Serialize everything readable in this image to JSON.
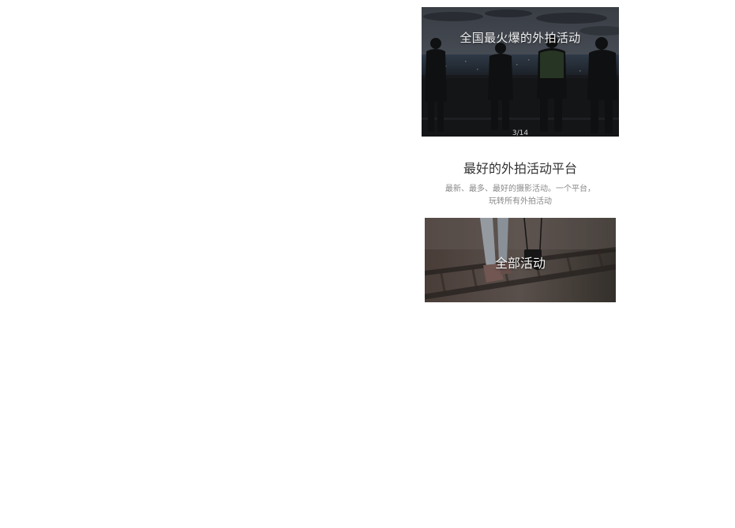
{
  "banner": {
    "title": "全国最火爆的外拍活动",
    "counter": "3/14",
    "image": "photographers-city-night-photo"
  },
  "intro": {
    "heading": "最好的外拍活动平台",
    "subtitle_line1": "最新、最多、最好的摄影活动。一个平台，",
    "subtitle_line2": "玩转所有外拍活动"
  },
  "all_activities": {
    "label": "全部活动",
    "image": "railway-walker-camera-photo"
  }
}
